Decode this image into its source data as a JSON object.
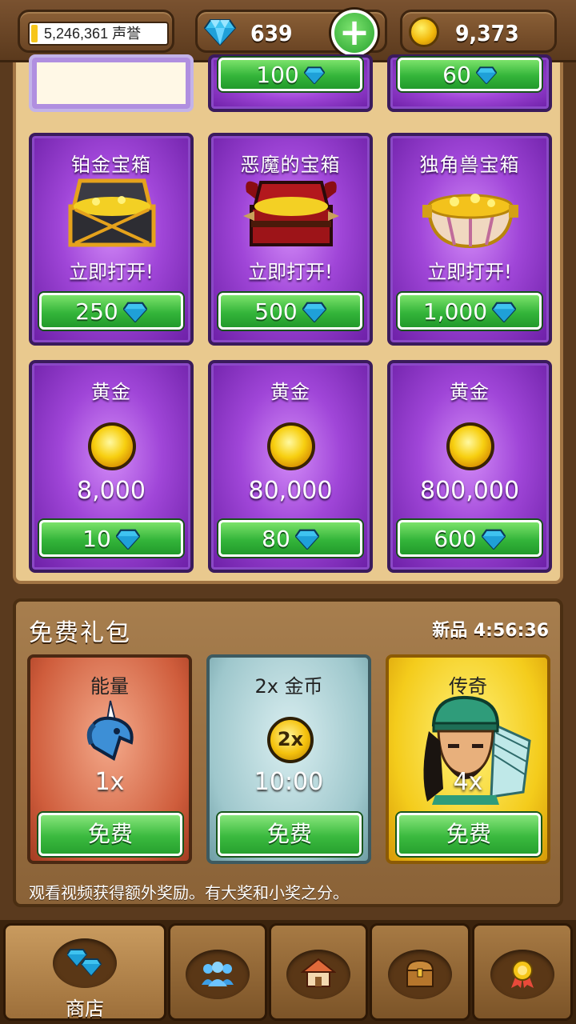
{
  "topbar": {
    "fame_value": "5,246,361",
    "fame_label": "声誉",
    "gems": "639",
    "gold": "9,373",
    "plus_symbol": "+"
  },
  "shop": {
    "partial_row": [
      {
        "price": "",
        "kind": "blank"
      },
      {
        "price": "100",
        "kind": "gems"
      },
      {
        "price": "60",
        "kind": "gems"
      }
    ],
    "chests": [
      {
        "title": "铂金宝箱",
        "sub": "立即打开!",
        "price": "250",
        "icon": "platinum-chest-icon"
      },
      {
        "title": "恶魔的宝箱",
        "sub": "立即打开!",
        "price": "500",
        "icon": "demon-chest-icon"
      },
      {
        "title": "独角兽宝箱",
        "sub": "立即打开!",
        "price": "1,000",
        "icon": "unicorn-chest-icon"
      }
    ],
    "gold_packs": [
      {
        "title": "黄金",
        "amount": "8,000",
        "price": "10"
      },
      {
        "title": "黄金",
        "amount": "80,000",
        "price": "80"
      },
      {
        "title": "黄金",
        "amount": "800,000",
        "price": "600"
      }
    ]
  },
  "free_packs": {
    "title": "免费礼包",
    "new_label": "新品 4:56:36",
    "cards": [
      {
        "title": "能量",
        "value": "1x",
        "button": "免费",
        "icon": "unicorn-head-icon"
      },
      {
        "title": "2x 金币",
        "value": "10:00",
        "button": "免费",
        "icon": "double-coin-icon",
        "badge": "2x"
      },
      {
        "title": "传奇",
        "value": "4x",
        "button": "免费",
        "icon": "legendary-hero-icon"
      }
    ],
    "note": "观看视频获得额外奖励。有大奖和小奖之分。"
  },
  "nav": [
    {
      "label": "商店",
      "icon": "diamonds-icon",
      "active": true
    },
    {
      "label": "",
      "icon": "people-icon"
    },
    {
      "label": "",
      "icon": "house-icon"
    },
    {
      "label": "",
      "icon": "chest-icon"
    },
    {
      "label": "",
      "icon": "medal-icon"
    }
  ],
  "colors": {
    "gem": "#3fc3f0",
    "gold": "#f2b90c",
    "button_green": "#34b53a",
    "card_purple": "#a046d8"
  }
}
